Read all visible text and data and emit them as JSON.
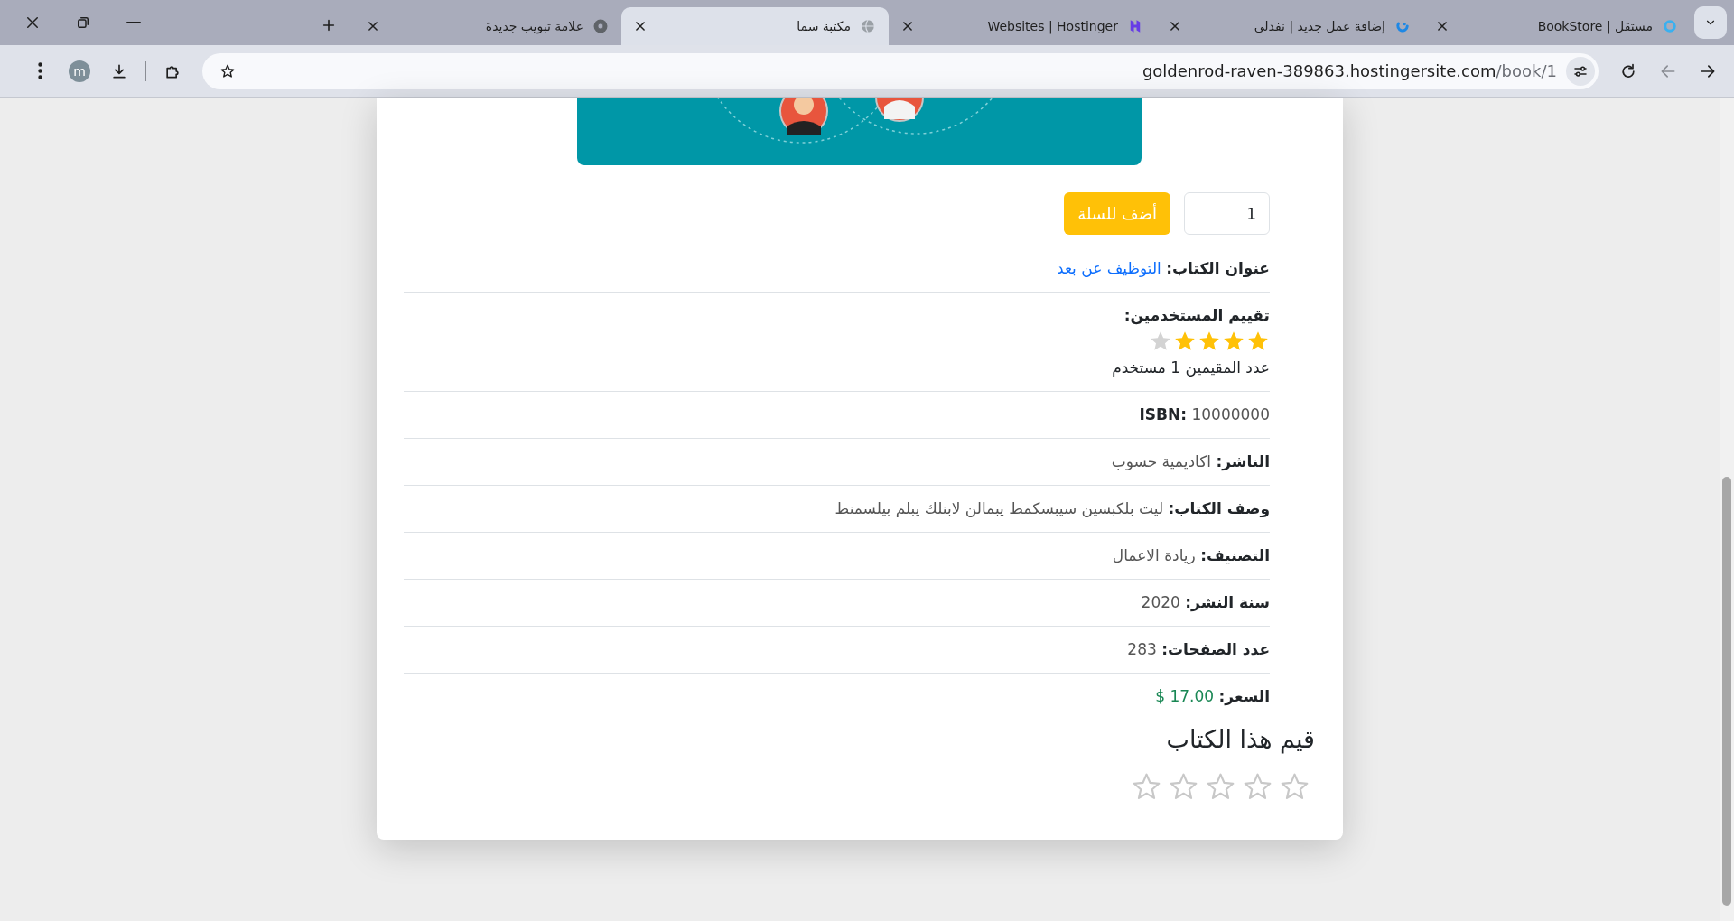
{
  "browser": {
    "tabs": [
      {
        "title": "مستقل | BookStore",
        "selected": false
      },
      {
        "title": "إضافة عمل جديد | نفذلي",
        "selected": false
      },
      {
        "title": "Websites | Hostinger",
        "selected": false
      },
      {
        "title": "مكتبة سما",
        "selected": true
      },
      {
        "title": "علامة تبويب جديدة",
        "selected": false
      }
    ],
    "url_host": "goldenrod-raven-389863.hostingersite.com",
    "url_path": "/book/1",
    "avatar": "m"
  },
  "page": {
    "cart": {
      "quantity": "1",
      "button": "أضف للسلة"
    },
    "details": [
      {
        "kind": "link",
        "label": "عنوان الكتاب:",
        "value": "التوظيف عن بعد"
      },
      {
        "kind": "rating",
        "label": "تقييم المستخدمين:",
        "stars": 4,
        "count": "عدد المقيمين 1 مستخدم"
      },
      {
        "kind": "text",
        "label": "ISBN:",
        "value": "10000000"
      },
      {
        "kind": "text",
        "label": "الناشر:",
        "value": "اكاديمية حسوب"
      },
      {
        "kind": "text",
        "label": "وصف الكتاب:",
        "value": "ليت بلكبسين سيبسكمط يبمالن لابنلك يبلم بيلسمنط"
      },
      {
        "kind": "text",
        "label": "التصنيف:",
        "value": "ريادة الاعمال"
      },
      {
        "kind": "text",
        "label": "سنة النشر:",
        "value": "2020"
      },
      {
        "kind": "text",
        "label": "عدد الصفحات:",
        "value": "283"
      },
      {
        "kind": "price",
        "label": "السعر:",
        "value": "$ 17.00"
      }
    ],
    "rate_heading": "قيم هذا الكتاب",
    "user_rating": {
      "stars": 0
    }
  }
}
